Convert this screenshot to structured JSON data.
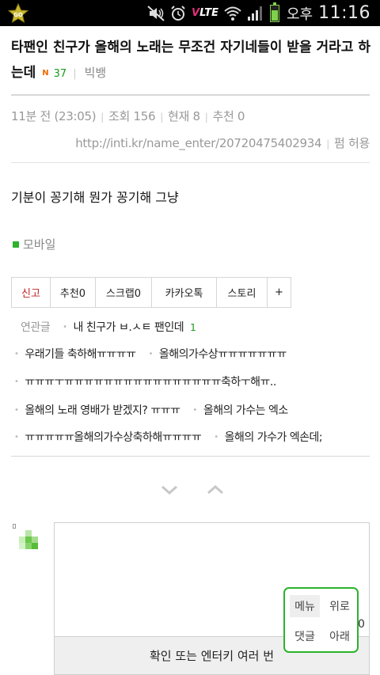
{
  "status_bar": {
    "network": "LTE",
    "ampm": "오후",
    "time": "11:16",
    "battery_level": 0.65,
    "icons": [
      "star-app-icon",
      "mute-icon",
      "alarm-icon",
      "lte-icon",
      "wifi-icon",
      "signal-icon",
      "battery-icon"
    ]
  },
  "post": {
    "title": "타팬인 친구가 올해의 노래는 무조건 자기네들이 받을 거라고 하는데",
    "new_badge": "N",
    "comment_count": "37",
    "author": "빅뱅",
    "time_ago": "11분 전",
    "time_exact": "(23:05)",
    "views": "조회 156",
    "current": "현재 8",
    "recommend": "추천 0",
    "url": "http://inti.kr/name_enter/20720475402934",
    "allow_copy": "펌 허용",
    "body": "기분이 꽁기해 뭔가 꽁기해 그냥",
    "source_tag": "모바일"
  },
  "actions": [
    {
      "label": "신고",
      "key": "report"
    },
    {
      "label": "추천0",
      "key": "recommend"
    },
    {
      "label": "스크랩0",
      "key": "scrap"
    },
    {
      "label": "카카오톡",
      "key": "kakaotalk"
    },
    {
      "label": "스토리",
      "key": "story"
    },
    {
      "label": "+",
      "key": "more"
    }
  ],
  "related": {
    "heading": "연관글",
    "first_item": "내 친구가 ㅂ.ㅅㅌ 팬인데",
    "first_count": "1",
    "items": [
      "우래기들 축하해ㅠㅠㅠㅠ",
      "올해의가수상ㅠㅠㅠㅠㅠㅠㅠ",
      "ㅠㅠㅠㅜㅠㅠㅠㅠㅠㅠㅠㅠㅠㅠㅠㅠㅠㅠㅠㅠ축하ㅜ해ㅠ..",
      "올해의 노래 영배가 받겠지? ㅠㅠㅠ",
      "올해의 가수는 엑소",
      "ㅠㅠㅠㅠㅠ올해의가수상축하해ㅠㅠㅠㅠ",
      "올해의 가수가 엑손데;"
    ]
  },
  "comment": {
    "char_count": "0",
    "submit_label": "확인 또는 엔터키 여러 번"
  },
  "float_menu": {
    "menu": "메뉴",
    "up": "위로",
    "comments": "댓글",
    "down": "아래"
  },
  "colors": {
    "accent_green": "#2cb32c",
    "report_red": "#c02020",
    "new_badge_orange": "#f26a00",
    "count_green": "#1a9a1a"
  }
}
